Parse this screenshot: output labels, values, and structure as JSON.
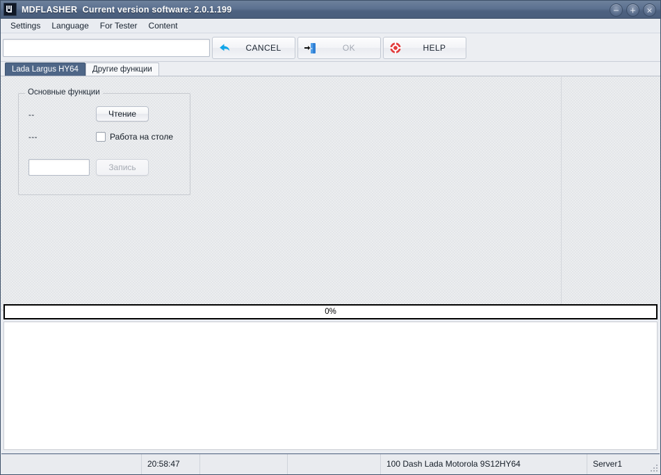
{
  "window": {
    "app_icon": "mdflasher-app-icon",
    "title_app": "MDFLASHER",
    "title_version": "Current version software: 2.0.1.199",
    "controls": {
      "minimize": "−",
      "maximize": "+",
      "close": "×"
    }
  },
  "menubar": {
    "items": [
      {
        "label": "Settings"
      },
      {
        "label": "Language"
      },
      {
        "label": "For Tester"
      },
      {
        "label": "Content"
      }
    ]
  },
  "toolbar": {
    "address_value": "",
    "address_placeholder": "",
    "buttons": [
      {
        "id": "cancel",
        "label": "CANCEL",
        "icon": "back-arrow-icon",
        "disabled": false
      },
      {
        "id": "ok",
        "label": "OK",
        "icon": "exit-door-icon",
        "disabled": true
      },
      {
        "id": "help",
        "label": "HELP",
        "icon": "lifebuoy-icon",
        "disabled": false
      }
    ]
  },
  "tabs": [
    {
      "label": "Lada Largus HY64",
      "active": true
    },
    {
      "label": "Другие функции",
      "active": false
    }
  ],
  "main": {
    "groupbox": {
      "title": "Основные функции",
      "label_row1": "--",
      "read_button": "Чтение",
      "label_row2": "---",
      "checkbox_label": "Работа на столе",
      "checkbox_checked": false,
      "text_value": "",
      "write_button": "Запись",
      "write_disabled": true
    }
  },
  "progress": {
    "percent_label": "0%",
    "value": 0
  },
  "log": {
    "text": ""
  },
  "statusbar": {
    "cells": [
      {
        "text": ""
      },
      {
        "text": "20:58:47"
      },
      {
        "text": ""
      },
      {
        "text": ""
      },
      {
        "text": "100 Dash Lada Motorola 9S12HY64"
      },
      {
        "text": "Server1"
      }
    ]
  },
  "colors": {
    "titlebar_top": "#6d819c",
    "titlebar_bottom": "#4a5e7c",
    "tab_active_bg": "#4e6687",
    "accent_blue": "#12a5e8",
    "help_red": "#e03b3b",
    "window_border": "#3d5068"
  }
}
